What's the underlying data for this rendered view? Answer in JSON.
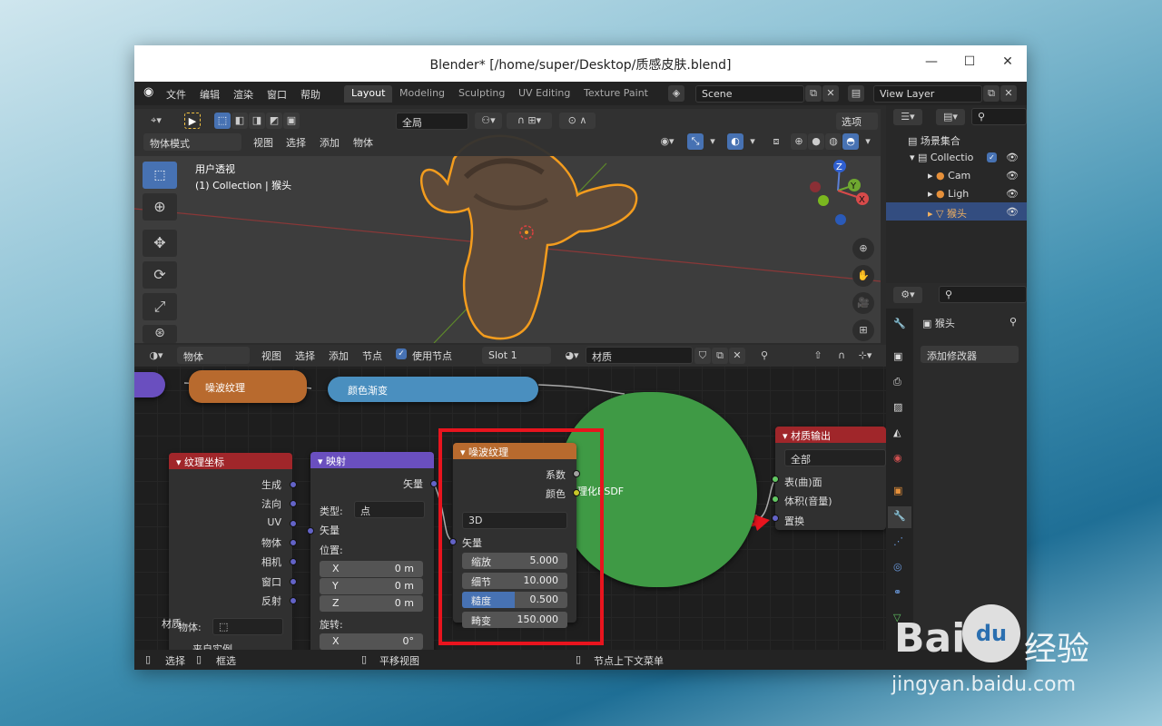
{
  "window": {
    "title": "Blender* [/home/super/Desktop/质感皮肤.blend]",
    "min": "—",
    "max": "☐",
    "close": "✕"
  },
  "menu": {
    "items": [
      "文件",
      "编辑",
      "渲染",
      "窗口",
      "帮助"
    ],
    "tabs": [
      "Layout",
      "Modeling",
      "Sculpting",
      "UV Editing",
      "Texture Paint"
    ],
    "scene": "Scene",
    "view_layer": "View Layer"
  },
  "viewport": {
    "orient": "全局",
    "options": "选项",
    "mode": "物体模式",
    "menus": [
      "视图",
      "选择",
      "添加",
      "物体"
    ],
    "overlay_title": "用户透视",
    "overlay_sub": "(1) Collection | 猴头",
    "gizmo": {
      "z": "Z",
      "y": "Y",
      "x": "X"
    }
  },
  "node_editor": {
    "type": "物体",
    "menus": [
      "视图",
      "选择",
      "添加",
      "节点"
    ],
    "use_nodes": "使用节点",
    "slot": "Slot 1",
    "material": "材质",
    "noise_top": "噪波纹理",
    "color_ramp": "颜色渐变",
    "texcoord": {
      "title": "纹理坐标",
      "outputs": [
        "生成",
        "法向",
        "UV",
        "物体",
        "相机",
        "窗口",
        "反射"
      ],
      "object_label": "物体:",
      "instancer": "来自实例"
    },
    "mapping": {
      "title": "映射",
      "output": "矢量",
      "type_label": "类型:",
      "type_value": "点",
      "vector": "矢量",
      "location": "位置:",
      "x": "X",
      "y": "Y",
      "z": "Z",
      "xv": "0 m",
      "yv": "0 m",
      "zv": "0 m",
      "rotation": "旋转:",
      "rx": "X",
      "rxv": "0°"
    },
    "noise": {
      "title": "噪波纹理",
      "out_fac": "系数",
      "out_color": "颜色",
      "dim": "3D",
      "vector": "矢量",
      "scale_label": "缩放",
      "scale": "5.000",
      "detail_label": "细节",
      "detail": "10.000",
      "rough_label": "糙度",
      "rough": "0.500",
      "rough_fill": 0.5,
      "distort_label": "畸变",
      "distort": "150.000"
    },
    "bsdf_label": "理化BSDF",
    "output": {
      "title": "材质输出",
      "target": "全部",
      "surface": "表(曲)面",
      "volume": "体积(音量)",
      "displace": "置换"
    },
    "side_label": "材质"
  },
  "outliner": {
    "root": "场景集合",
    "collection": "Collectio",
    "items": [
      "Cam",
      "Ligh",
      "猴头"
    ]
  },
  "properties": {
    "object": "猴头",
    "add_modifier": "添加修改器"
  },
  "status": {
    "select": "选择",
    "box": "框选",
    "pan": "平移视图",
    "ctx": "节点上下文菜单"
  },
  "watermark": {
    "brand": "Bai",
    "du": "du",
    "suffix": "经验",
    "url": "jingyan.baidu.com"
  },
  "colors": {
    "accent": "#4772b3",
    "highlight": "#e8141e",
    "noise_header": "#b86a2e",
    "ramp_header": "#4a8fbf",
    "texcoord_header": "#a0262a",
    "mapping_header": "#6a4fbf",
    "output_header": "#a0262a",
    "bsdf": "#3f9a45"
  }
}
